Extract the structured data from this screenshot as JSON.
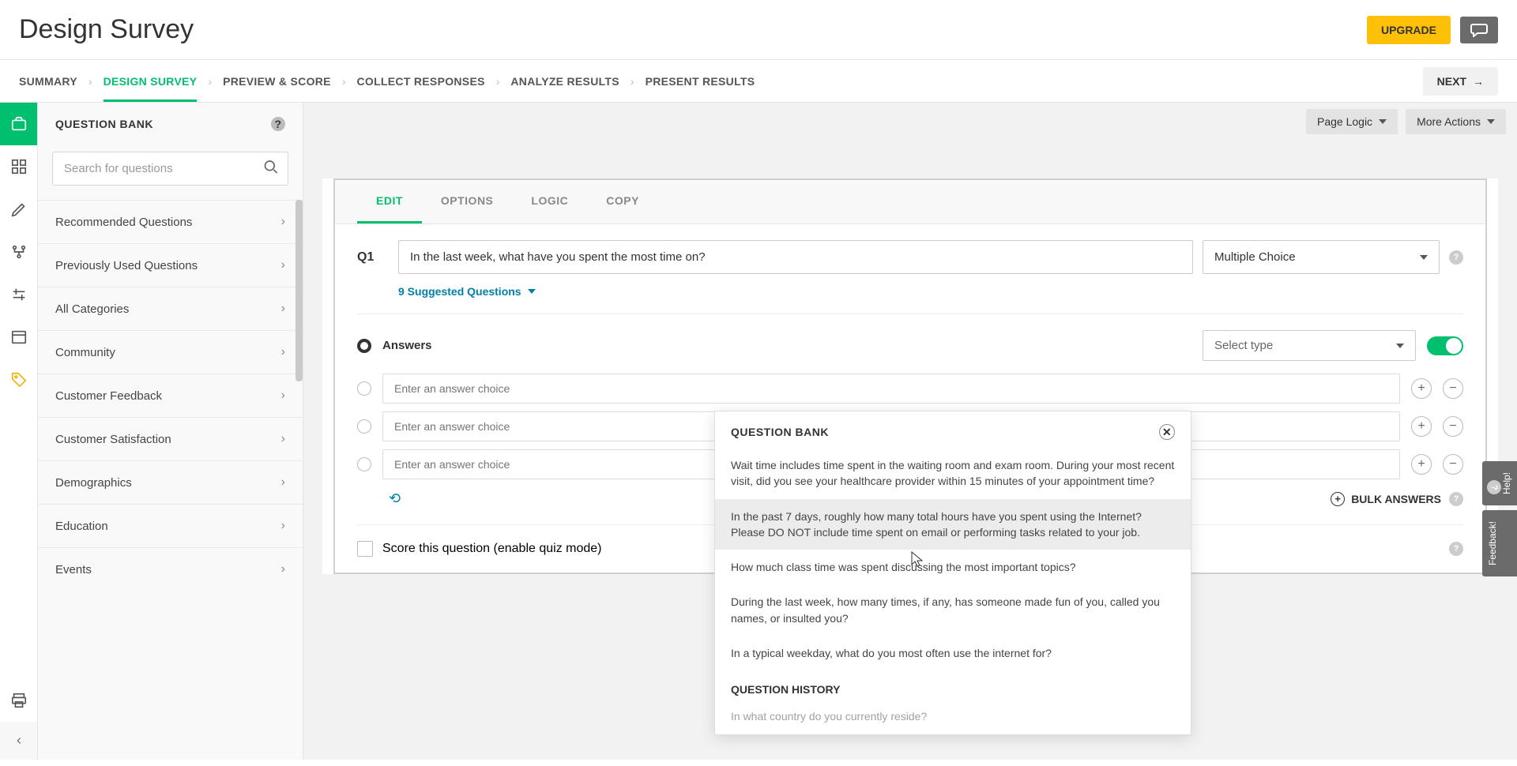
{
  "header": {
    "title": "Design Survey",
    "upgrade": "UPGRADE",
    "next": "NEXT"
  },
  "nav": {
    "steps": [
      "SUMMARY",
      "DESIGN SURVEY",
      "PREVIEW & SCORE",
      "COLLECT RESPONSES",
      "ANALYZE RESULTS",
      "PRESENT RESULTS"
    ],
    "active_index": 1
  },
  "sidebar": {
    "title": "QUESTION BANK",
    "search_placeholder": "Search for questions",
    "items": [
      "Recommended Questions",
      "Previously Used Questions",
      "All Categories",
      "Community",
      "Customer Feedback",
      "Customer Satisfaction",
      "Demographics",
      "Education",
      "Events"
    ]
  },
  "pagebar": {
    "logic": "Page Logic",
    "actions": "More Actions"
  },
  "question": {
    "tabs": [
      "EDIT",
      "OPTIONS",
      "LOGIC",
      "COPY"
    ],
    "active_tab": 0,
    "label": "Q1",
    "text": "In the last week, what have you spent the most time on?",
    "type": "Multiple Choice",
    "suggested": "9 Suggested Questions",
    "answers_label": "Answers",
    "select_type": "Select type",
    "answer_placeholder": "Enter an answer choice",
    "bulk": "BULK ANSWERS",
    "score": "Score this question (enable quiz mode)"
  },
  "popover": {
    "title": "QUESTION BANK",
    "items": [
      "Wait time includes time spent in the waiting room and exam room. During your most recent visit, did you see your healthcare provider within 15 minutes of your appointment time?",
      "In the past 7 days, roughly how many total hours have you spent using the Internet? Please DO NOT include time spent on email or performing tasks related to your job.",
      "How much class time was spent discussing the most important topics?",
      "During the last week, how many times, if any, has someone made fun of you, called you names, or insulted you?",
      "In a typical weekday, what do you most often use the internet for?"
    ],
    "hover_index": 1,
    "history_title": "QUESTION HISTORY",
    "history_item": "In what country do you currently reside?"
  },
  "side_tabs": {
    "help": "Help!",
    "feedback": "Feedback!"
  }
}
